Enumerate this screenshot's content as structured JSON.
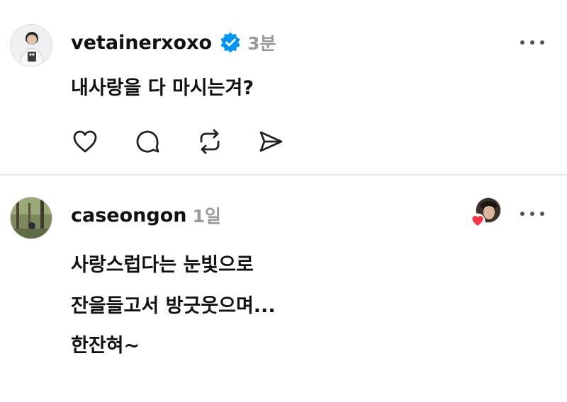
{
  "posts": [
    {
      "username": "vetainerxoxo",
      "verified": true,
      "time": "3분",
      "text": "내사랑을 다 마시는겨?",
      "actions": [
        "like-icon",
        "comment-icon",
        "repost-icon",
        "share-icon"
      ]
    },
    {
      "username": "caseongon",
      "time": "1일",
      "lines": [
        "사랑스럽다는 눈빛으로",
        "잔을들고서 방긋웃으며...",
        "한잔혀~"
      ],
      "liked_by_author": true
    }
  ],
  "colors": {
    "verified": "#0095f6",
    "heart": "#ff3040",
    "time": "#9a9a9a",
    "divider": "#e6e6e6"
  }
}
